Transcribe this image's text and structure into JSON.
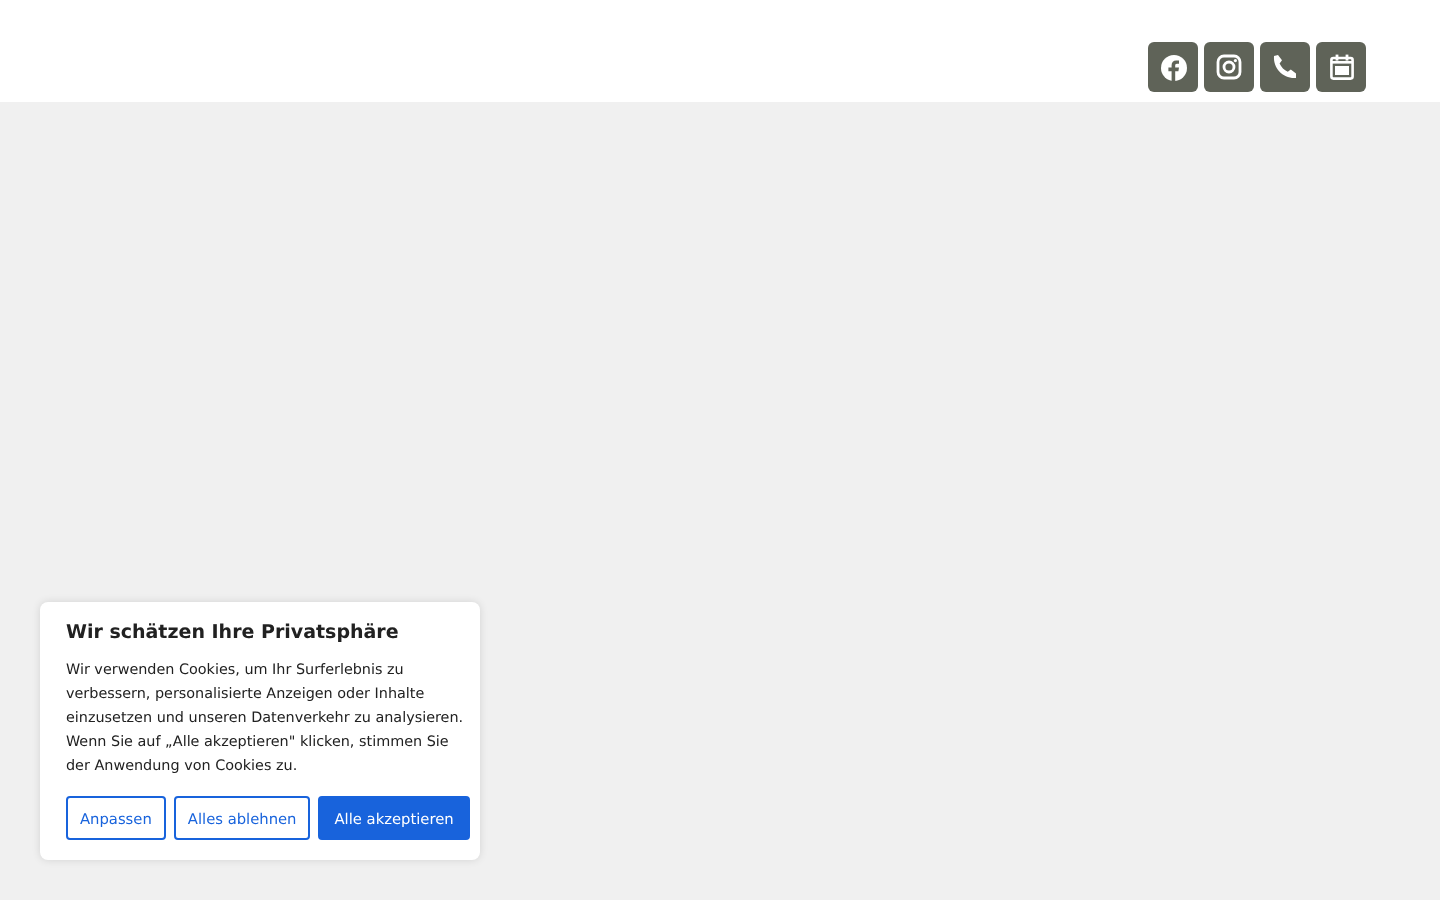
{
  "header": {
    "icons": [
      {
        "kind": "facebook"
      },
      {
        "kind": "instagram"
      },
      {
        "kind": "phone"
      },
      {
        "kind": "calendar"
      }
    ]
  },
  "cookie_banner": {
    "title": "Wir schätzen Ihre Privatsphäre",
    "text": "Wir verwenden Cookies, um Ihr Surferlebnis zu verbessern, personalisierte Anzeigen oder Inhalte einzusetzen und unseren Datenverkehr zu analysieren. Wenn Sie auf „Alle akzeptieren\" klicken, stimmen Sie der Anwendung von Cookies zu.",
    "buttons": [
      {
        "label": "Anpassen",
        "kind": "outline"
      },
      {
        "label": "Alles ablehnen",
        "kind": "outline"
      },
      {
        "label": "Alle akzeptieren",
        "kind": "primary"
      }
    ]
  }
}
